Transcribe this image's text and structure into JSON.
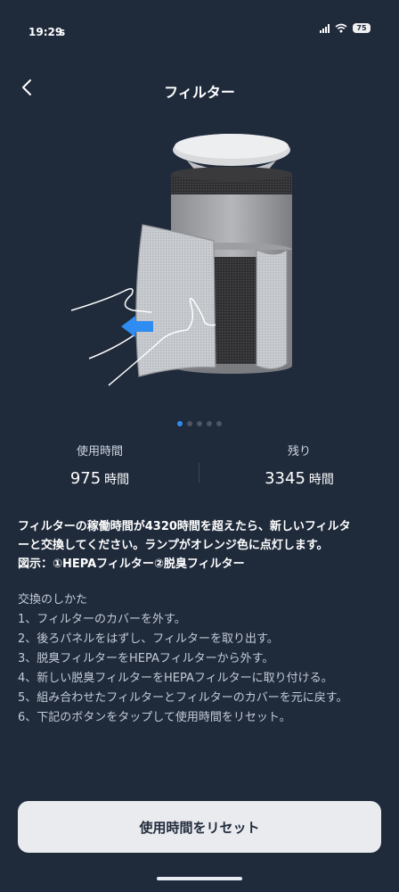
{
  "status_bar": {
    "time": "19:29",
    "extra": "s",
    "battery": "75"
  },
  "nav": {
    "title": "フィルター"
  },
  "carousel": {
    "page_count": 5,
    "active_page": 1
  },
  "stats": {
    "used": {
      "label": "使用時間",
      "value": "975",
      "unit": "時間"
    },
    "remaining": {
      "label": "残り",
      "value": "3345",
      "unit": "時間"
    }
  },
  "notice": {
    "line1": "フィルターの稼働時間が4320時間を超えたら、新しいフィルタ",
    "line2": "ーと交換してください。ランプがオレンジ色に点灯します。",
    "line3": "図示：①HEPAフィルター②脱臭フィルター"
  },
  "steps": {
    "heading": "交換のしかた",
    "items": [
      "1、フィルターのカバーを外す。",
      "2、後ろパネルをはずし、フィルターを取り出す。",
      "3、脱臭フィルターをHEPAフィルターから外す。",
      "4、新しい脱臭フィルターをHEPAフィルターに取り付ける。",
      "5、組み合わせたフィルターとフィルターのカバーを元に戻す。",
      "6、下記のボタンをタップして使用時間をリセット。"
    ]
  },
  "reset_button": {
    "label": "使用時間をリセット"
  },
  "colors": {
    "background": "#1f2a3b",
    "accent": "#2f8cf0",
    "button_bg": "#e9ebee"
  }
}
